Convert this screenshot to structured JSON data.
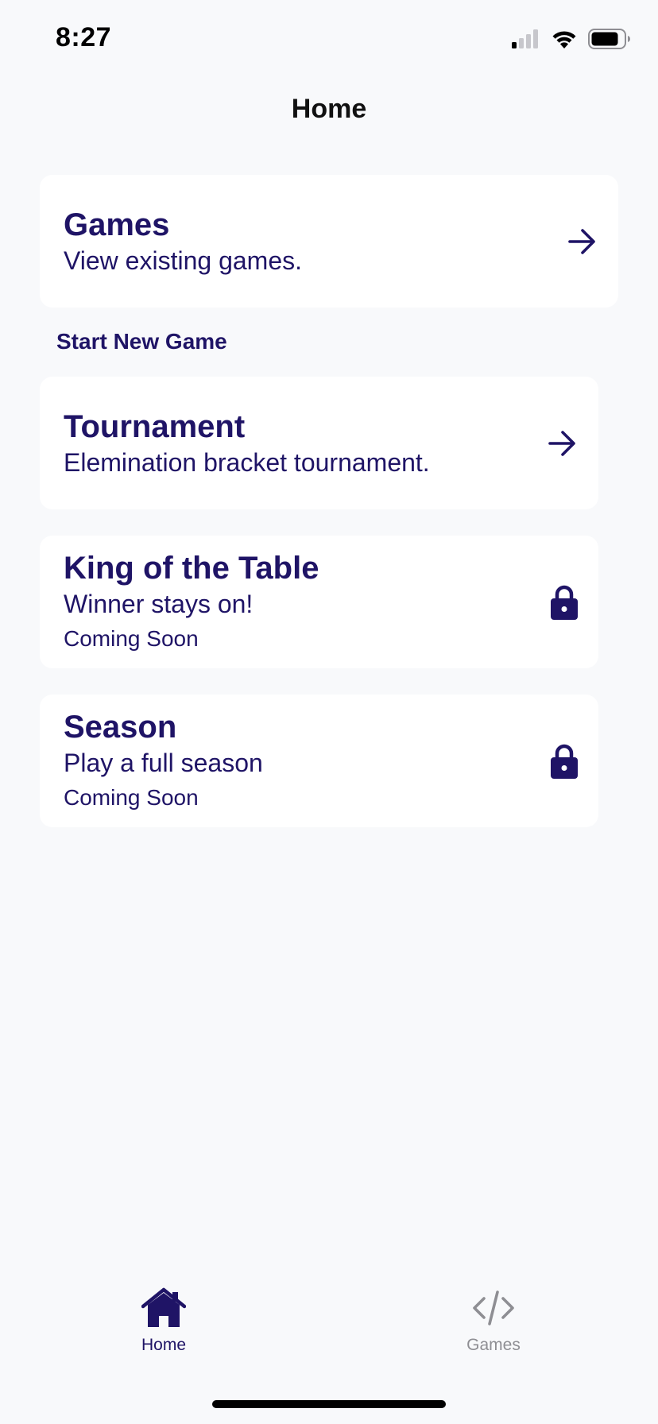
{
  "status_bar": {
    "time": "8:27"
  },
  "nav": {
    "title": "Home"
  },
  "games_card": {
    "title": "Games",
    "subtitle": "View existing games.",
    "icon": "arrow-right-icon"
  },
  "section": {
    "label": "Start New Game"
  },
  "modes": [
    {
      "title": "Tournament",
      "subtitle": "Elemination bracket tournament.",
      "note": "",
      "icon": "arrow-right-icon",
      "locked": false
    },
    {
      "title": "King of the Table",
      "subtitle": "Winner stays on!",
      "note": "Coming Soon",
      "icon": "lock-icon",
      "locked": true
    },
    {
      "title": "Season",
      "subtitle": "Play a full season",
      "note": "Coming Soon",
      "icon": "lock-icon",
      "locked": true
    }
  ],
  "tab_bar": {
    "tabs": [
      {
        "label": "Home",
        "icon": "home-icon",
        "active": true
      },
      {
        "label": "Games",
        "icon": "code-icon",
        "active": false
      }
    ]
  },
  "colors": {
    "accent": "#1f1466",
    "background": "#f8f9fb",
    "card": "#ffffff",
    "inactive_tab": "#8e8e93"
  }
}
